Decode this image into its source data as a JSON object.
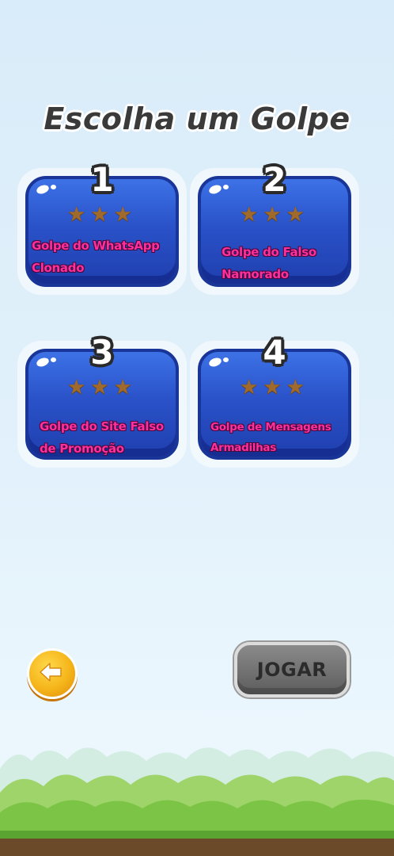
{
  "title": "Escolha um Golpe",
  "levels": [
    {
      "number": "1",
      "stars": "★★★",
      "label_line1": "Golpe do WhatsApp",
      "label_line2": "Clonado"
    },
    {
      "number": "2",
      "stars": "★★★",
      "label_line1": "Golpe do Falso",
      "label_line2": "Namorado"
    },
    {
      "number": "3",
      "stars": "★★★",
      "label_line1": "Golpe do Site Falso",
      "label_line2": "de Promoção"
    },
    {
      "number": "4",
      "stars": "★★★",
      "label_line1": "Golpe de Mensagens",
      "label_line2": "Armadilhas"
    }
  ],
  "buttons": {
    "play_label": "JOGAR",
    "back_icon": "arrow-left-icon"
  },
  "colors": {
    "card_blue": "#2a52c9",
    "label_pink": "#ff2f9b",
    "star_bronze": "#a06a2c",
    "back_orange": "#f5b51a",
    "play_gray": "#6f6f6f"
  }
}
